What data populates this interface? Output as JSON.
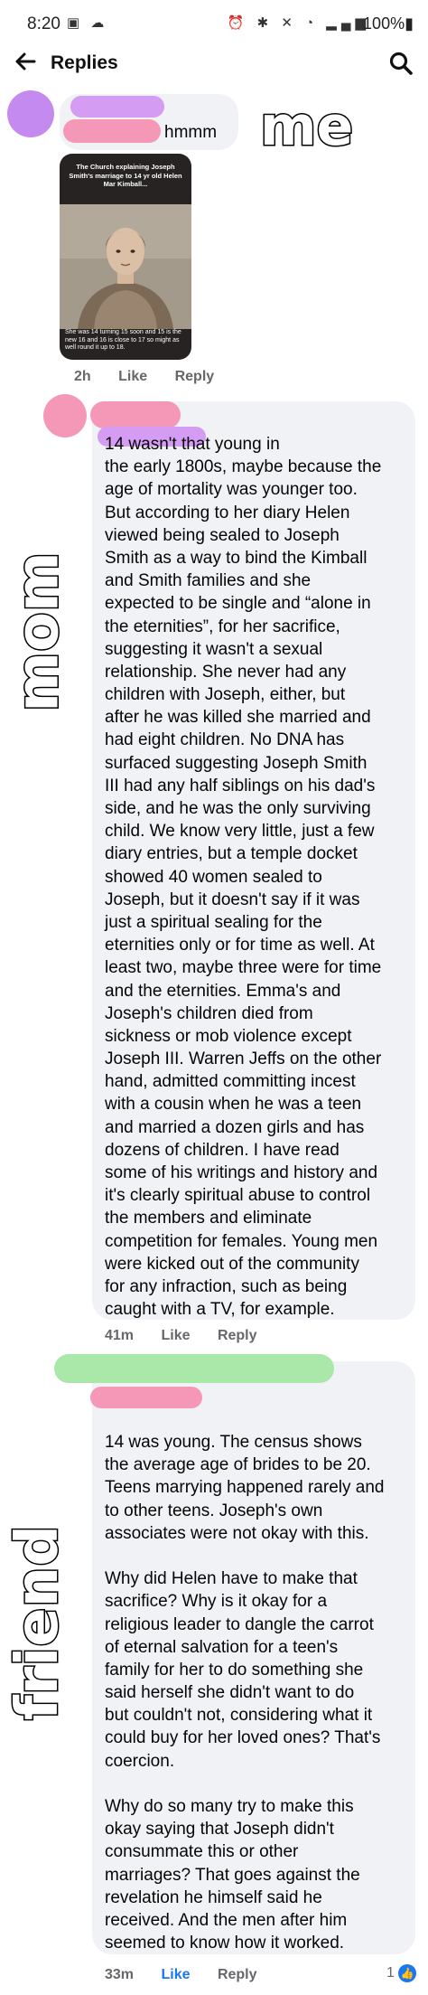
{
  "status_bar": {
    "time": "8:20",
    "battery": "100%"
  },
  "header": {
    "title": "Replies"
  },
  "annotations": {
    "me": "me",
    "mom": "mom",
    "friend": "friend"
  },
  "comment_me": {
    "text": "hmmm",
    "image": {
      "caption_top": "The Church explaining Joseph Smith's marriage to 14 yr old Helen Mar Kimball...",
      "caption_bottom": "She was 14 turning 15 soon and 15 is the new 16 and 16 is close to 17 so might as well round it up to 18."
    },
    "time": "2h",
    "like": "Like",
    "reply": "Reply"
  },
  "comment_mom": {
    "lines": [
      "14 wasn't that young in",
      "the early 1800s, maybe because the",
      "age of mortality was younger too.",
      "But according to her diary Helen",
      "viewed being sealed to Joseph",
      "Smith as a way to bind the Kimball",
      "and Smith families and she",
      "expected to be single and “alone in",
      "the eternities”, for her sacrifice,",
      "suggesting it wasn't a sexual",
      "relationship. She never had any",
      "children with Joseph, either, but",
      "after he was killed she married and",
      "had eight children. No DNA has",
      "surfaced suggesting Joseph Smith",
      "III had any half siblings on his dad's",
      "side, and he was the only surviving",
      "child. We know very little, just a few",
      "diary entries, but a temple docket",
      "showed 40 women sealed to",
      "Joseph, but it doesn't say if it was",
      "just a spiritual sealing for the",
      "eternities only or for time as well. At",
      "least two, maybe three were for time",
      "and the eternities. Emma's and",
      "Joseph's children died from",
      "sickness or mob violence except",
      "Joseph III. Warren Jeffs on the other",
      "hand, admitted committing incest",
      "with a cousin when he was a teen",
      "and married a dozen girls and has",
      "dozens of children. I have read",
      "some of his writings and history and",
      "it's clearly spiritual abuse to control",
      "the members and eliminate",
      "competition for females. Young men",
      "were kicked out of the community",
      "for any infraction, such as being",
      "caught with a TV, for example."
    ],
    "time": "41m",
    "like": "Like",
    "reply": "Reply"
  },
  "comment_friend": {
    "lines": [
      "14 was young. The census shows",
      "the average age of brides to be 20.",
      "Teens marrying happened rarely and",
      "to other teens. Joseph's own",
      "associates were not okay with this.",
      "",
      "Why did Helen have to make that",
      "sacrifice? Why is it okay for a",
      "religious leader to dangle the carrot",
      "of eternal salvation for a teen's",
      "family for her to do something she",
      "said herself she didn't want to do",
      "but couldn't not, considering what it",
      "could buy for her loved ones? That's",
      "coercion.",
      "",
      "Why do so many try to make this",
      "okay saying that Joseph didn't",
      "consummate this or other",
      "marriages? That goes against the",
      "revelation he himself said he",
      "received. And the men after him",
      "seemed to know how it worked."
    ],
    "time": "33m",
    "like": "Like",
    "reply": "Reply",
    "reaction_count": "1"
  },
  "colors": {
    "me_avatar": "#c58af0",
    "me_name_top": "#d49cf2",
    "me_name_bottom": "#f598b8",
    "mom_avatar": "#f598b8",
    "mom_name_top": "#f598b8",
    "mom_name_bottom": "#d49cf2",
    "friend_name_top": "#a9e8a9",
    "friend_name_bottom": "#f598b8",
    "like_active": "#1877f2"
  }
}
